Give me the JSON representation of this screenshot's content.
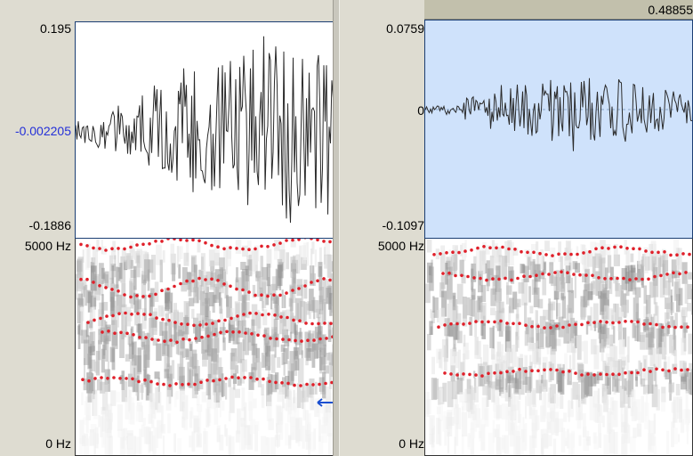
{
  "left_window": {
    "waveform": {
      "y_max": "0.195",
      "y_center": "-0.002205",
      "y_min": "-0.1886"
    },
    "spectrogram": {
      "freq_max": "5000 Hz",
      "freq_min": "0 Hz"
    }
  },
  "right_window": {
    "selection_time": "0.48855",
    "waveform": {
      "y_max": "0.0759",
      "y_center": "0",
      "y_min": "-0.1097"
    },
    "spectrogram": {
      "freq_max": "5000 Hz",
      "freq_min": "0 Hz"
    }
  },
  "colors": {
    "formant_dots": "#e0202a",
    "selection_fill": "#cfe2fb",
    "cursor_arrow": "#1a4fd0",
    "waveform_fill": "#2a2a2a"
  }
}
